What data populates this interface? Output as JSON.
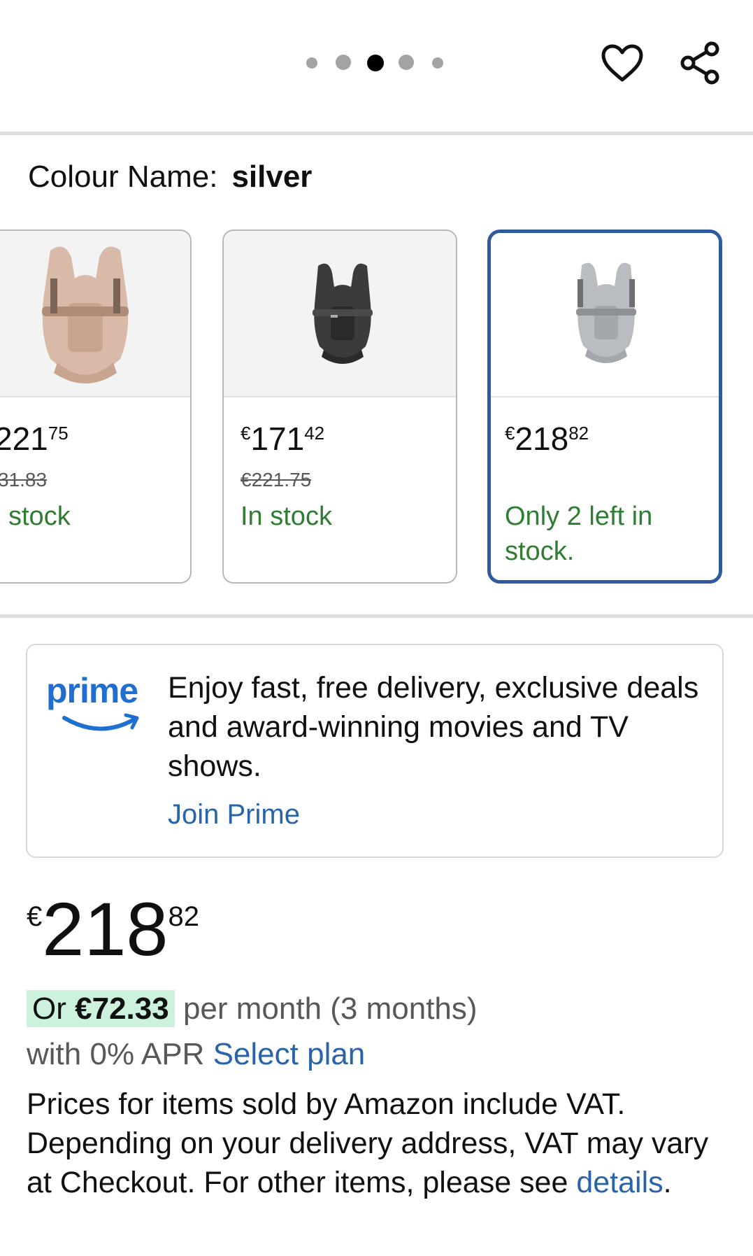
{
  "carousel": {
    "dot_count": 5,
    "active_dot": 3
  },
  "header_icons": {
    "wishlist": "heart-icon",
    "share": "share-icon"
  },
  "colour": {
    "label": "Colour Name:",
    "value": "silver"
  },
  "swatches": [
    {
      "image": "baby-carrier-pink",
      "price_whole": "221",
      "price_cents": "75",
      "old_price": "31.83",
      "stock": "stock"
    },
    {
      "image": "baby-carrier-black",
      "price_currency": "€",
      "price_whole": "171",
      "price_cents": "42",
      "old_price": "€221.75",
      "stock": "In stock"
    },
    {
      "image": "baby-carrier-silver",
      "price_currency": "€",
      "price_whole": "218",
      "price_cents": "82",
      "stock": "Only 2 left in stock."
    }
  ],
  "prime": {
    "logo": "prime",
    "text": "Enjoy fast, free delivery, exclusive deals and award-winning movies and TV shows.",
    "join_label": "Join Prime"
  },
  "price": {
    "currency": "€",
    "whole": "218",
    "cents": "82"
  },
  "instalment": {
    "or": "Or",
    "amount": "€72.33",
    "per_month": "per month (3 months)",
    "apr": "with 0% APR",
    "select_plan": "Select plan"
  },
  "vat": {
    "text": "Prices for items sold by Amazon include VAT. Depending on your delivery address, VAT may vary at Checkout. For other items, please see",
    "link": "details",
    "end": "."
  },
  "colors": {
    "accent": "#2a64a8",
    "prime_blue": "#1f6fd0",
    "in_stock": "#2e7d32",
    "selected_border": "#2f5a9e",
    "instalment_bg": "#ccf1dd"
  }
}
